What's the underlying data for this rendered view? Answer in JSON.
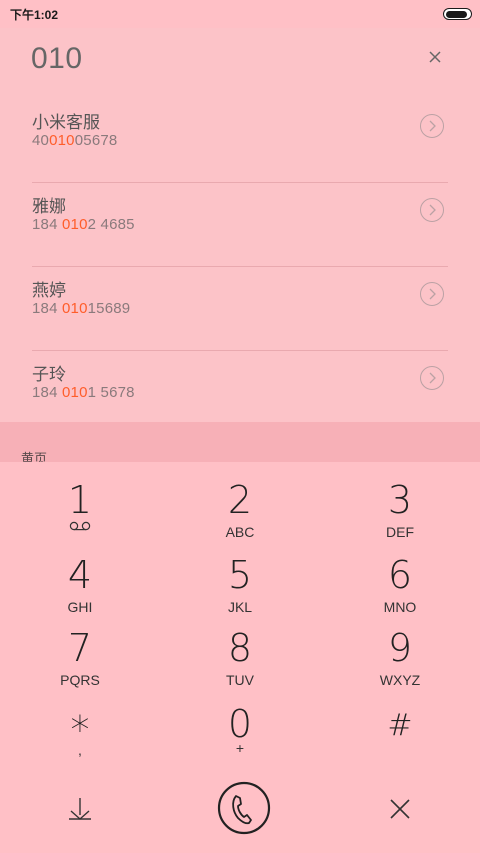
{
  "status_bar": {
    "time": "下午1:02"
  },
  "dialed": {
    "number": "010"
  },
  "contacts": [
    {
      "name": "小米客服",
      "pre": "40",
      "match": "010",
      "post": "05678"
    },
    {
      "name": "雅娜",
      "pre": "184 ",
      "match": "010",
      "post": "2 4685"
    },
    {
      "name": "燕婷",
      "pre": "184 ",
      "match": "010",
      "post": "15689"
    },
    {
      "name": "子玲",
      "pre": "184 ",
      "match": "010",
      "post": "1 5678"
    }
  ],
  "yellow_pages": {
    "label": "黄页"
  },
  "keypad": {
    "keys": [
      {
        "digit": "1",
        "letters": ""
      },
      {
        "digit": "2",
        "letters": "ABC"
      },
      {
        "digit": "3",
        "letters": "DEF"
      },
      {
        "digit": "4",
        "letters": "GHI"
      },
      {
        "digit": "5",
        "letters": "JKL"
      },
      {
        "digit": "6",
        "letters": "MNO"
      },
      {
        "digit": "7",
        "letters": "PQRS"
      },
      {
        "digit": "8",
        "letters": "TUV"
      },
      {
        "digit": "9",
        "letters": "WXYZ"
      },
      {
        "digit": "*",
        "letters": ","
      },
      {
        "digit": "0",
        "letters": "+"
      },
      {
        "digit": "#",
        "letters": ""
      }
    ]
  },
  "colors": {
    "highlight": "#ff5d2a",
    "background": "#ffc0c6"
  },
  "icons": {
    "voicemail": "voicemail-icon",
    "collapse": "collapse-keypad-icon",
    "call": "phone-call-icon",
    "delete": "delete-icon"
  }
}
